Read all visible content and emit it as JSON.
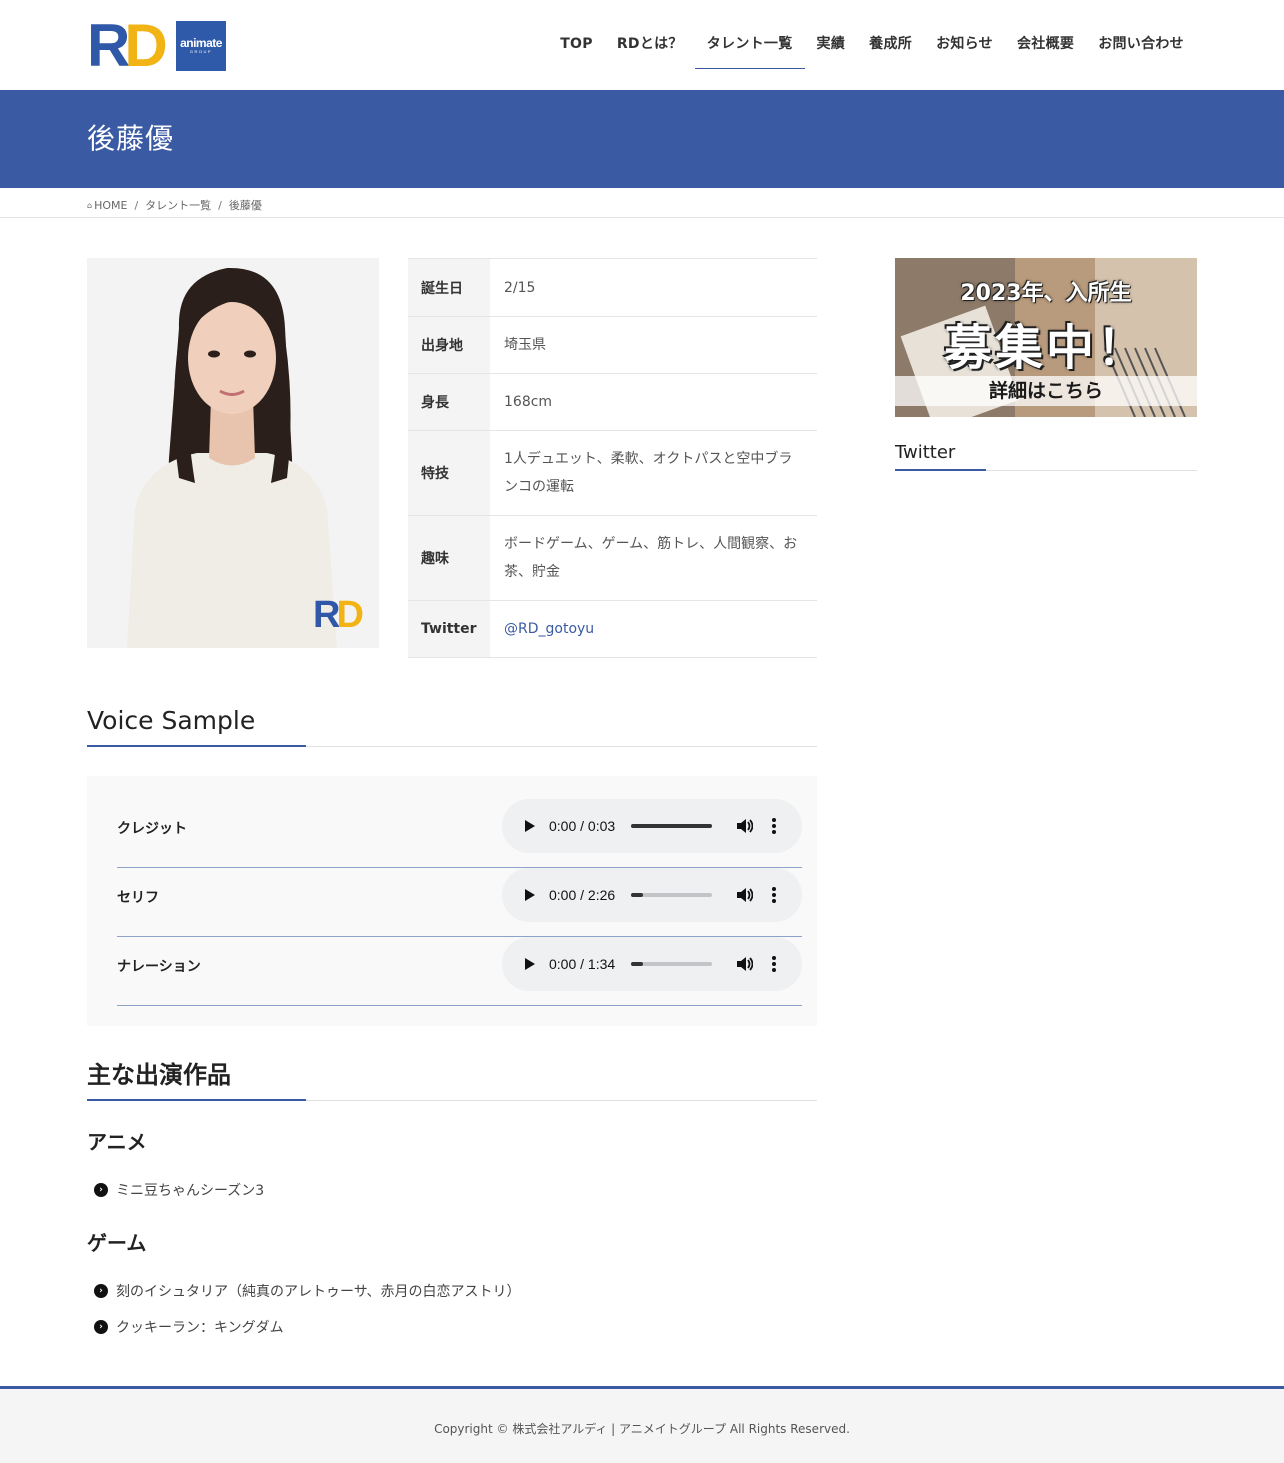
{
  "header": {
    "logo": {
      "rd": "RD",
      "group_line1": "animate",
      "group_line2": "GROUP"
    },
    "nav": [
      "TOP",
      "RDとは？",
      "タレント一覧",
      "実績",
      "養成所",
      "お知らせ",
      "会社概要",
      "お問い合わせ"
    ],
    "current_nav": "タレント一覧"
  },
  "page_title": "後藤優",
  "breadcrumb": {
    "home": "HOME",
    "parent": "タレント一覧",
    "current": "後藤優"
  },
  "photo": {
    "watermark": "RD"
  },
  "profile": [
    {
      "label": "誕生日",
      "value": "2/15"
    },
    {
      "label": "出身地",
      "value": "埼玉県"
    },
    {
      "label": "身長",
      "value": "168cm"
    },
    {
      "label": "特技",
      "value": "1人デュエット、柔軟、オクトパスと空中ブランコの運転"
    },
    {
      "label": "趣味",
      "value": "ボードゲーム、ゲーム、筋トレ、人間観察、お茶、貯金"
    },
    {
      "label": "Twitter",
      "value": "@RD_gotoyu"
    }
  ],
  "voice": {
    "title": "Voice Sample",
    "samples": [
      {
        "label": "クレジット",
        "time": "0:00 / 0:03",
        "progress": 1.0
      },
      {
        "label": "セリフ",
        "time": "0:00 / 2:26",
        "progress": 0.15
      },
      {
        "label": "ナレーション",
        "time": "0:00 / 1:34",
        "progress": 0.15
      }
    ]
  },
  "works": {
    "title": "主な出演作品",
    "anime": {
      "title": "アニメ",
      "items": [
        "ミニ豆ちゃんシーズン3"
      ]
    },
    "game": {
      "title": "ゲーム",
      "items": [
        "刻のイシュタリア（純真のアレトゥーサ、赤月の白恋アストリ）",
        "クッキーラン：キングダム"
      ]
    }
  },
  "sidebar": {
    "banner": {
      "line1": "2023年、入所生",
      "line2": "募集中！",
      "line3": "詳細はこちら"
    },
    "twitter_title": "Twitter"
  },
  "footer": {
    "copyright": "Copyright © 株式会社アルディ | アニメイトグループ All Rights Reserved."
  },
  "colors": {
    "brand_blue": "#3a5ba3",
    "logo_yellow": "#f2b315"
  }
}
